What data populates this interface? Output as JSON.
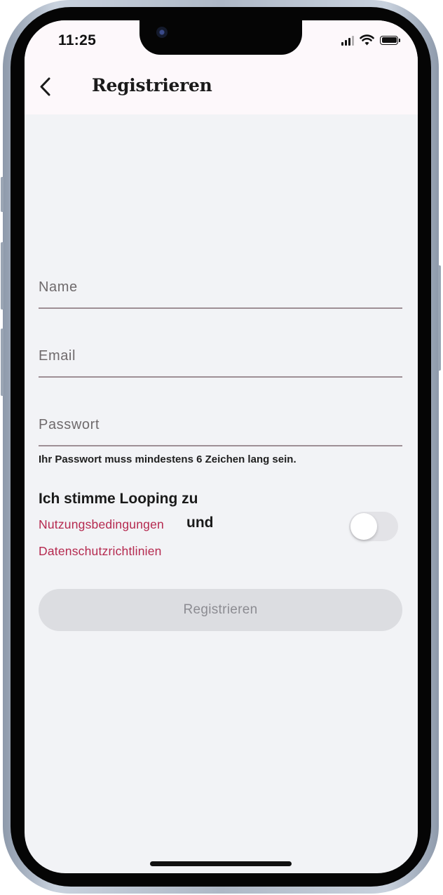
{
  "status_bar": {
    "time": "11:25"
  },
  "nav": {
    "title": "Registrieren"
  },
  "form": {
    "name_placeholder": "Name",
    "email_placeholder": "Email",
    "password_placeholder": "Passwort",
    "password_hint": "Ihr Passwort muss mindestens 6 Zeichen lang sein."
  },
  "terms": {
    "intro": "Ich stimme Looping zu",
    "terms_link": "Nutzungsbedingungen",
    "connector": "und",
    "privacy_link": "Datenschutzrichtlinien",
    "accepted": false
  },
  "submit": {
    "label": "Registrieren",
    "enabled": false
  },
  "colors": {
    "accent_link": "#b5294f",
    "header_bg": "#fdf8fb",
    "screen_bg": "#f2f3f6",
    "button_disabled_bg": "#dcdde1"
  },
  "icons": {
    "back": "chevron-left-icon",
    "signal": "cellular-signal-icon",
    "wifi": "wifi-icon",
    "battery": "battery-icon"
  }
}
